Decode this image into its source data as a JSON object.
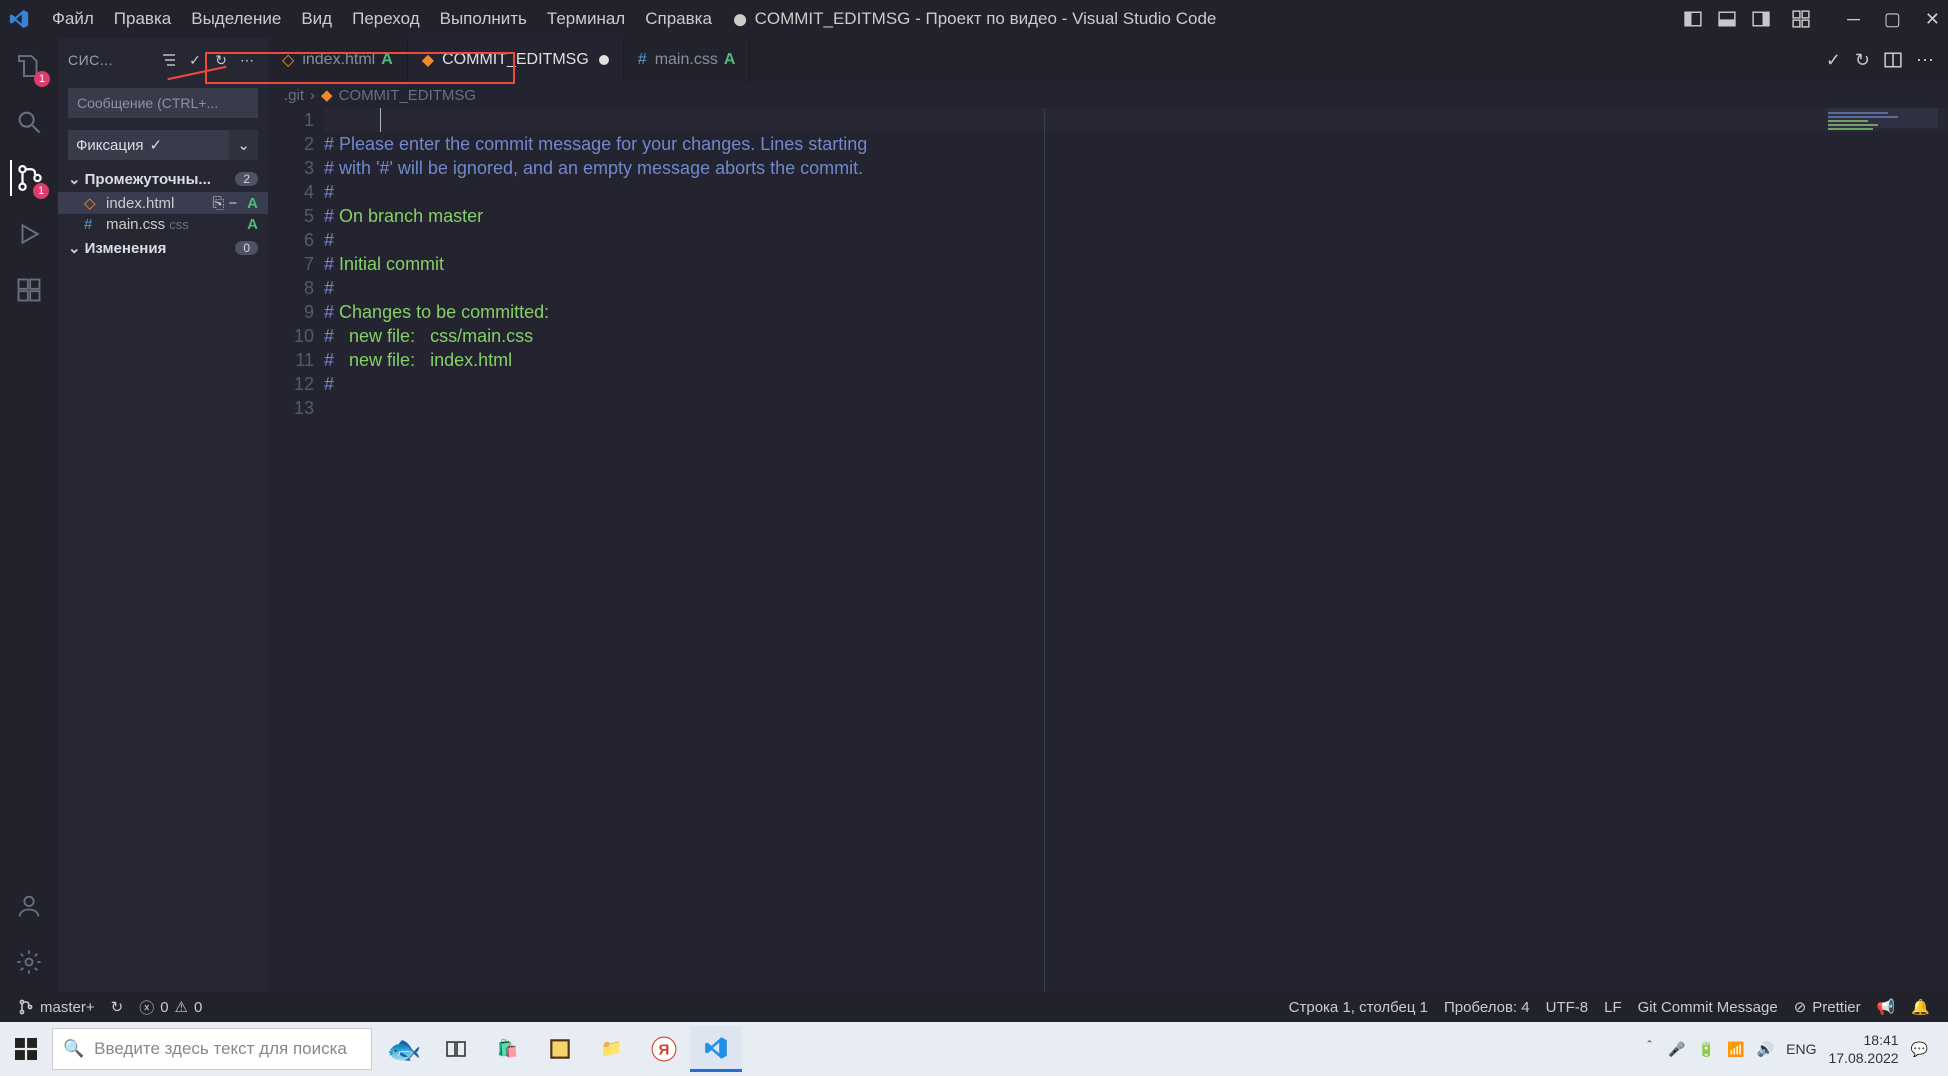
{
  "menu": [
    "Файл",
    "Правка",
    "Выделение",
    "Вид",
    "Переход",
    "Выполнить",
    "Терминал",
    "Справка"
  ],
  "window_title": "COMMIT_EDITMSG - Проект по видео - Visual Studio Code",
  "activity": {
    "explorer_badge": "1",
    "scm_badge": "1"
  },
  "sidebar": {
    "header": "СИС...",
    "commit_placeholder": "Сообщение (CTRL+...",
    "commit_btn": "Фиксация",
    "staged_label": "Промежуточны...",
    "staged_count": "2",
    "changes_label": "Изменения",
    "changes_count": "0",
    "files": [
      {
        "name": "index.html",
        "status": "A"
      },
      {
        "name": "main.css",
        "ext": "css",
        "status": "A"
      }
    ]
  },
  "tabs": [
    {
      "name": "index.html",
      "status": "A",
      "icon": "html",
      "active": false
    },
    {
      "name": "COMMIT_EDITMSG",
      "dirty": true,
      "icon": "git",
      "active": true
    },
    {
      "name": "main.css",
      "status": "A",
      "icon": "css",
      "active": false
    }
  ],
  "breadcrumb": {
    "folder": ".git",
    "file": "COMMIT_EDITMSG"
  },
  "code": {
    "lines": [
      "",
      "# Please enter the commit message for your changes. Lines starting",
      "# with '#' will be ignored, and an empty message aborts the commit.",
      "#",
      "# On branch master",
      "#",
      "# Initial commit",
      "#",
      "# Changes to be committed:",
      "#   new file:   css/main.css",
      "#   new file:   index.html",
      "#",
      ""
    ]
  },
  "status": {
    "branch": "master+",
    "errors": "0",
    "warnings": "0",
    "cursor": "Строка 1, столбец 1",
    "spaces": "Пробелов: 4",
    "encoding": "UTF-8",
    "eol": "LF",
    "lang": "Git Commit Message",
    "prettier": "Prettier"
  },
  "taskbar": {
    "search_placeholder": "Введите здесь текст для поиска",
    "lang": "ENG",
    "time": "18:41",
    "date": "17.08.2022"
  }
}
